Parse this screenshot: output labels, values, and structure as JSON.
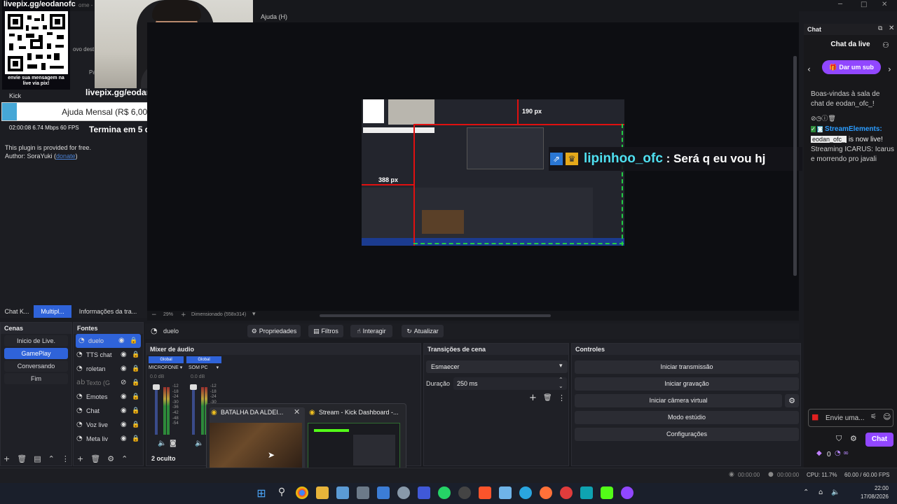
{
  "window": {
    "title_fragment": "ome - C",
    "menu_help": "Ajuda (H)",
    "menu_update": "ualizar"
  },
  "overlay": {
    "pix_url_top": "livepix.gg/eodanofc",
    "pix_caption": "envie sua mensagem na live via pix!",
    "pix_url_bottom": "livepix.gg/eodanofc",
    "platform": "Kick",
    "goal_label": "Ajuda Mensal (R$ 6,00/R$ 100,00)",
    "goal_progress": 0.06,
    "stats": "02:00:08  6.74 Mbps  60 FPS",
    "ends": "Termina em 5 dias",
    "plugin_line1": "This plugin is provided for free.",
    "plugin_line2": "Author: SoraYuki (",
    "plugin_donate": "donate",
    "plugin_close": ")",
    "behind_fragment1": "ovo dest",
    "behind_fragment2": "Pa"
  },
  "preview": {
    "dim_top": "190 px",
    "dim_left": "388 px",
    "chat_user": "lipinhoo_ofc",
    "chat_sep": " : ",
    "chat_msg": "Será q eu vou hj",
    "zoom": "29%",
    "dims": "Dimensionado (558x314)"
  },
  "dock_tabs": [
    "Chat K...",
    "Multipl...",
    "Informações da tra..."
  ],
  "scenes": {
    "title": "Cenas",
    "items": [
      {
        "label": "Inicio de Live."
      },
      {
        "label": "GamePlay",
        "active": true
      },
      {
        "label": "Conversando"
      },
      {
        "label": "Fim"
      }
    ]
  },
  "sources": {
    "title": "Fontes",
    "items": [
      {
        "label": "duelo",
        "selected": true
      },
      {
        "label": "TTS chat"
      },
      {
        "label": "roletan"
      },
      {
        "label": "Texto (G",
        "disabled": true
      },
      {
        "label": "Emotes"
      },
      {
        "label": "Chat"
      },
      {
        "label": "Voz live"
      },
      {
        "label": "Meta liv"
      }
    ]
  },
  "source_toolbar": {
    "name": "duelo",
    "props": "Propriedades",
    "filters": "Filtros",
    "interact": "Interagir",
    "refresh": "Atualizar"
  },
  "mixer": {
    "title": "Mixer de áudio",
    "channels": [
      {
        "global": "Global",
        "name": "MICROFONE",
        "db": "0.0 dB"
      },
      {
        "global": "Global",
        "name": "SOM PC",
        "db": "0.0 dB"
      }
    ],
    "scale": [
      "-12",
      "-18",
      "-24",
      "-30",
      "-36",
      "-42",
      "-48",
      "-54"
    ],
    "hidden": "2 oculto"
  },
  "transitions": {
    "title": "Transições de cena",
    "selected": "Esmaecer",
    "duration_label": "Duração",
    "duration_value": "250 ms"
  },
  "controls": {
    "title": "Controles",
    "buttons": [
      "Iniciar transmissão",
      "Iniciar gravação",
      "Iniciar câmera virtual",
      "Modo estúdio",
      "Configurações"
    ]
  },
  "thumbnails": [
    {
      "title": "BATALHA DA ALDEI..."
    },
    {
      "title": "Stream - Kick Dashboard -..."
    }
  ],
  "chat": {
    "panel_title": "Chat",
    "header": "Chat da live",
    "sub_button": "Dar um sub",
    "welcome": "Boas-vindas à sala de chat de eodan_ofc_!",
    "bot_name": "StreamElements:",
    "msg_name": "eodan_ofc_",
    "msg_text": "is now live!",
    "msg_rest": "Streaming ICARUS: Icarus e morrendo pro javali",
    "input_placeholder": "Envie uma...",
    "chat_button": "Chat",
    "points": "0"
  },
  "status": {
    "rec_time": "00:00:00",
    "stream_time": "00:00:00",
    "cpu": "CPU: 11.7%",
    "fps": "60.00 / 60.00 FPS"
  },
  "clock": {
    "time": "22:00",
    "date": "17/08/2026"
  },
  "colors": {
    "accent": "#2f63d9",
    "kick": "#53fc18",
    "twitch": "#9147ff",
    "red": "#e01010"
  }
}
